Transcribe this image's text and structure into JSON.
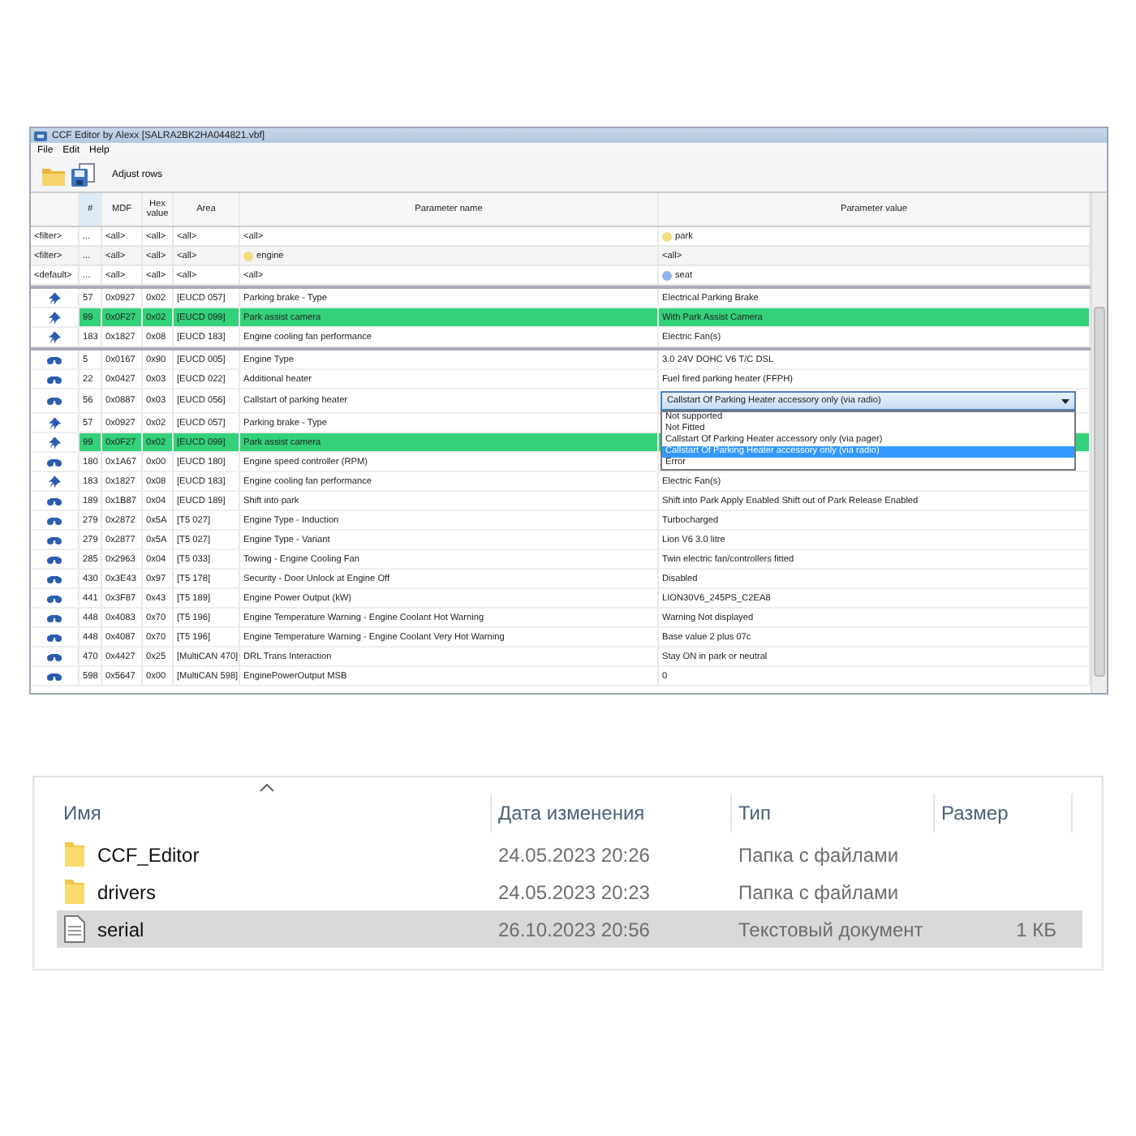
{
  "window": {
    "title": "CCF Editor by Alexx [SALRA2BK2HA044821.vbf]"
  },
  "menu": [
    "File",
    "Edit",
    "Help"
  ],
  "toolbar": {
    "adjust_label": "Adjust rows"
  },
  "columns": [
    "#",
    "MDF",
    "Hex value",
    "Area",
    "Parameter name",
    "Parameter value"
  ],
  "filters": [
    {
      "label": "<filter>",
      "num": "...",
      "mdf": "<all>",
      "hex": "<all>",
      "area": "<all>",
      "name": {
        "text": "<all>"
      },
      "value": {
        "text": "park",
        "color": "#f3dc7a"
      }
    },
    {
      "label": "<filter>",
      "num": "...",
      "mdf": "<all>",
      "hex": "<all>",
      "area": "<all>",
      "name": {
        "text": "engine",
        "color": "#f3dc7a"
      },
      "value": {
        "text": "<all>"
      }
    },
    {
      "label": "<default>",
      "num": "...",
      "mdf": "<all>",
      "hex": "<all>",
      "area": "<all>",
      "name": {
        "text": "<all>"
      },
      "value": {
        "text": "seat",
        "color": "#8fb6e8"
      }
    }
  ],
  "pinned_rows": [
    {
      "kind": "pin",
      "num": "57",
      "mdf": "0x0927",
      "hex": "0x02",
      "area": "[EUCD 057]",
      "name": "Parking brake  -  Type",
      "value": "Electrical Parking Brake",
      "highlighted": false
    },
    {
      "kind": "pin",
      "num": "99",
      "mdf": "0x0F27",
      "hex": "0x02",
      "area": "[EUCD 099]",
      "name": "Park assist camera",
      "value": "With Park Assist Camera",
      "highlighted": true
    },
    {
      "kind": "pin",
      "num": "183",
      "mdf": "0x1827",
      "hex": "0x08",
      "area": "[EUCD 183]",
      "name": "Engine cooling fan performance",
      "value": "Electric Fan(s)",
      "highlighted": false
    }
  ],
  "rows": [
    {
      "kind": "binoculars",
      "num": "5",
      "mdf": "0x0167",
      "hex": "0x90",
      "area": "[EUCD 005]",
      "name": "Engine Type",
      "value": "3.0 24V DOHC V6 T/C DSL",
      "highlighted": false
    },
    {
      "kind": "binoculars",
      "num": "22",
      "mdf": "0x0427",
      "hex": "0x03",
      "area": "[EUCD 022]",
      "name": "Additional heater",
      "value": "Fuel fired parking heater (FFPH)",
      "highlighted": false
    },
    {
      "kind": "binoculars",
      "num": "56",
      "mdf": "0x0887",
      "hex": "0x03",
      "area": "[EUCD 056]",
      "name": "Callstart of parking heater",
      "highlighted": false,
      "dropdown": {
        "value": "Callstart Of Parking Heater accessory only (via radio)",
        "options": [
          {
            "label": "Not supported",
            "selected": false
          },
          {
            "label": "Not Fitted",
            "selected": false
          },
          {
            "label": "Callstart Of Parking Heater accessory only (via pager)",
            "selected": false
          },
          {
            "label": "Callstart Of Parking Heater accessory only (via radio)",
            "selected": true
          },
          {
            "label": "Error",
            "selected": false
          }
        ]
      }
    },
    {
      "kind": "pin",
      "num": "57",
      "mdf": "0x0927",
      "hex": "0x02",
      "area": "[EUCD 057]",
      "name": "Parking brake  -  Type",
      "highlighted": false
    },
    {
      "kind": "pin",
      "num": "99",
      "mdf": "0x0F27",
      "hex": "0x02",
      "area": "[EUCD 099]",
      "name": "Park assist camera",
      "highlighted": true
    },
    {
      "kind": "binoculars",
      "num": "180",
      "mdf": "0x1A67",
      "hex": "0x00",
      "area": "[EUCD 180]",
      "name": "Engine speed controller (RPM)",
      "highlighted": false
    },
    {
      "kind": "pin",
      "num": "183",
      "mdf": "0x1827",
      "hex": "0x08",
      "area": "[EUCD 183]",
      "name": "Engine cooling fan performance",
      "value": "Electric Fan(s)",
      "highlighted": false
    },
    {
      "kind": "binoculars",
      "num": "189",
      "mdf": "0x1B87",
      "hex": "0x04",
      "area": "[EUCD 189]",
      "name": "Shift into park",
      "value": "Shift into Park Apply Enabled Shift out of Park Release Enabled",
      "highlighted": false
    },
    {
      "kind": "binoculars",
      "num": "279",
      "mdf": "0x2872",
      "hex": "0x5A",
      "area": "[T5 027]",
      "name": "Engine Type - Induction",
      "value": "Turbocharged",
      "highlighted": false
    },
    {
      "kind": "binoculars",
      "num": "279",
      "mdf": "0x2877",
      "hex": "0x5A",
      "area": "[T5 027]",
      "name": "Engine Type - Variant",
      "value": "Lion V6 3.0 litre",
      "highlighted": false
    },
    {
      "kind": "binoculars",
      "num": "285",
      "mdf": "0x2963",
      "hex": "0x04",
      "area": "[T5 033]",
      "name": "Towing - Engine Cooling Fan",
      "value": "Twin electric fan/controllers fitted",
      "highlighted": false
    },
    {
      "kind": "binoculars",
      "num": "430",
      "mdf": "0x3E43",
      "hex": "0x97",
      "area": "[T5 178]",
      "name": "Security - Door Unlock at Engine Off",
      "value": "Disabled",
      "highlighted": false
    },
    {
      "kind": "binoculars",
      "num": "441",
      "mdf": "0x3F87",
      "hex": "0x43",
      "area": "[T5 189]",
      "name": "Engine Power Output (kW)",
      "value": "LION30V6_245PS_C2EA8",
      "highlighted": false
    },
    {
      "kind": "binoculars",
      "num": "448",
      "mdf": "0x4083",
      "hex": "0x70",
      "area": "[T5 196]",
      "name": "Engine Temperature Warning - Engine Coolant Hot Warning",
      "value": "Warning Not displayed",
      "highlighted": false
    },
    {
      "kind": "binoculars",
      "num": "448",
      "mdf": "0x4087",
      "hex": "0x70",
      "area": "[T5 196]",
      "name": "Engine Temperature Warning - Engine Coolant Very Hot Warning",
      "value": "Base value 2 plus 07c",
      "highlighted": false
    },
    {
      "kind": "binoculars",
      "num": "470",
      "mdf": "0x4427",
      "hex": "0x25",
      "area": "[MultiCAN 470]",
      "name": "DRL Trans Interaction",
      "value": "Stay ON in park or neutral",
      "highlighted": false
    },
    {
      "kind": "binoculars",
      "num": "598",
      "mdf": "0x5647",
      "hex": "0x00",
      "area": "[MultiCAN 598]",
      "name": "EnginePowerOutput MSB",
      "value": "0",
      "highlighted": false
    }
  ],
  "explorer": {
    "columns": [
      {
        "label": "Имя",
        "sorted": true
      },
      {
        "label": "Дата изменения",
        "sorted": false
      },
      {
        "label": "Тип",
        "sorted": false
      },
      {
        "label": "Размер",
        "sorted": false
      }
    ],
    "files": [
      {
        "kind": "folder",
        "name": "CCF_Editor",
        "date": "24.05.2023 20:26",
        "type": "Папка с файлами",
        "selected": false
      },
      {
        "kind": "folder",
        "name": "drivers",
        "date": "24.05.2023 20:23",
        "type": "Папка с файлами",
        "selected": false
      },
      {
        "kind": "file",
        "name": "serial",
        "date": "26.10.2023 20:56",
        "type": "Текстовый документ",
        "size": "1 КБ",
        "selected": true
      }
    ]
  }
}
